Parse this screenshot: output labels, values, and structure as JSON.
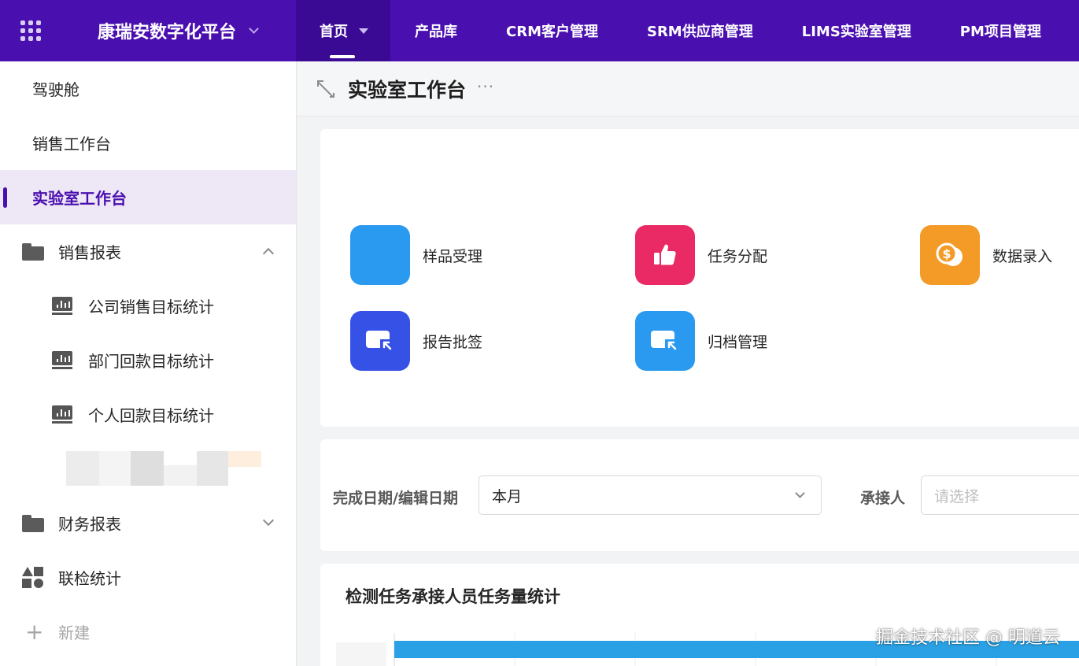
{
  "topbar": {
    "brand": "康瑞安数字化平台",
    "nav": [
      {
        "label": "首页"
      },
      {
        "label": "产品库"
      },
      {
        "label": "CRM客户管理"
      },
      {
        "label": "SRM供应商管理"
      },
      {
        "label": "LIMS实验室管理"
      },
      {
        "label": "PM项目管理"
      }
    ],
    "colors": {
      "bar": "#4a0faf",
      "active": "#3b0a95"
    }
  },
  "sidebar": {
    "items": [
      {
        "label": "驾驶舱"
      },
      {
        "label": "销售工作台"
      },
      {
        "label": "实验室工作台"
      },
      {
        "label": "销售报表",
        "icon": "folder-icon"
      },
      {
        "label": "公司销售目标统计",
        "icon": "chart-board-icon"
      },
      {
        "label": "部门回款目标统计",
        "icon": "chart-board-icon"
      },
      {
        "label": "个人回款目标统计",
        "icon": "chart-board-icon"
      },
      {
        "label": "财务报表",
        "icon": "folder-icon"
      },
      {
        "label": "联检统计",
        "icon": "apps-icon"
      },
      {
        "label": "新建",
        "icon": "plus-icon"
      }
    ]
  },
  "page": {
    "title": "实验室工作台",
    "more": "···"
  },
  "quick_actions": [
    {
      "label": "样品受理",
      "color": "#2a9af0"
    },
    {
      "label": "任务分配",
      "color": "#ea2a64",
      "icon": "thumbs-up-icon"
    },
    {
      "label": "数据录入",
      "color": "#f49a27",
      "icon": "coins-icon"
    },
    {
      "label": "报告批签",
      "color": "#3651e6",
      "icon": "screen-pointer-icon"
    },
    {
      "label": "归档管理",
      "color": "#2a9af0",
      "icon": "screen-pointer-icon"
    }
  ],
  "filters": {
    "date_label": "完成日期/编辑日期",
    "date_value": "本月",
    "assignee_label": "承接人",
    "assignee_placeholder": "请选择"
  },
  "chart": {
    "title": "检测任务承接人员任务量统计"
  },
  "chart_data": {
    "type": "bar",
    "title": "检测任务承接人员任务量统计",
    "orientation": "horizontal",
    "bar_color": "#2aa1e4"
  },
  "footer_watermark": "掘金技术社区 @ 明道云"
}
